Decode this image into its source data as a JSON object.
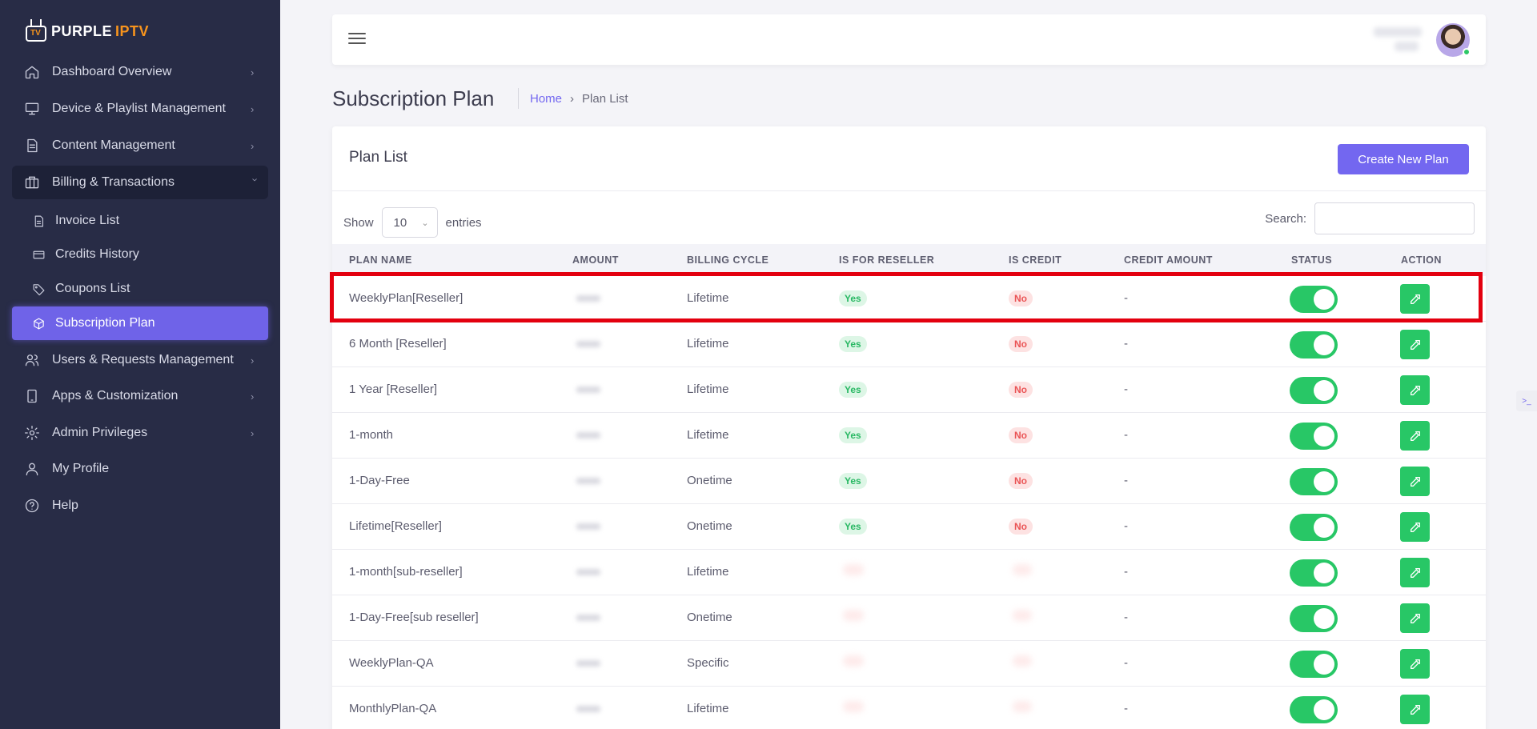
{
  "brand": {
    "name_primary": "PURPLE",
    "name_accent": "IPTV",
    "tv_label": "TV"
  },
  "sidebar": {
    "items": [
      {
        "label": "Dashboard Overview"
      },
      {
        "label": "Device & Playlist Management"
      },
      {
        "label": "Content Management"
      },
      {
        "label": "Billing & Transactions"
      },
      {
        "label": "Users & Requests Management"
      },
      {
        "label": "Apps & Customization"
      },
      {
        "label": "Admin Privileges"
      },
      {
        "label": "My Profile"
      },
      {
        "label": "Help"
      }
    ],
    "billing_sub": [
      {
        "label": "Invoice List"
      },
      {
        "label": "Credits History"
      },
      {
        "label": "Coupons List"
      },
      {
        "label": "Subscription Plan"
      }
    ]
  },
  "page": {
    "title": "Subscription Plan",
    "breadcrumb_home": "Home",
    "breadcrumb_sep": "›",
    "breadcrumb_current": "Plan List"
  },
  "card": {
    "title": "Plan List",
    "create_label": "Create New Plan",
    "show_label": "Show",
    "entries_value": "10",
    "entries_label": "entries",
    "search_label": "Search:"
  },
  "table": {
    "headers": [
      "PLAN NAME",
      "AMOUNT",
      "BILLING CYCLE",
      "IS FOR RESELLER",
      "IS CREDIT",
      "CREDIT AMOUNT",
      "STATUS",
      "ACTION"
    ],
    "rows": [
      {
        "name": "WeeklyPlan[Reseller]",
        "cycle": "Lifetime",
        "reseller": "Yes",
        "credit": "No",
        "credit_amount": "-"
      },
      {
        "name": "6 Month [Reseller]",
        "cycle": "Lifetime",
        "reseller": "Yes",
        "credit": "No",
        "credit_amount": "-"
      },
      {
        "name": "1 Year [Reseller]",
        "cycle": "Lifetime",
        "reseller": "Yes",
        "credit": "No",
        "credit_amount": "-"
      },
      {
        "name": "1-month",
        "cycle": "Lifetime",
        "reseller": "Yes",
        "credit": "No",
        "credit_amount": "-"
      },
      {
        "name": "1-Day-Free",
        "cycle": "Onetime",
        "reseller": "Yes",
        "credit": "No",
        "credit_amount": "-"
      },
      {
        "name": "Lifetime[Reseller]",
        "cycle": "Onetime",
        "reseller": "Yes",
        "credit": "No",
        "credit_amount": "-"
      },
      {
        "name": "1-month[sub-reseller]",
        "cycle": "Lifetime",
        "reseller": "",
        "credit": "",
        "credit_amount": "-"
      },
      {
        "name": "1-Day-Free[sub reseller]",
        "cycle": "Onetime",
        "reseller": "",
        "credit": "",
        "credit_amount": "-"
      },
      {
        "name": "WeeklyPlan-QA",
        "cycle": "Specific",
        "reseller": "",
        "credit": "",
        "credit_amount": "-"
      },
      {
        "name": "MonthlyPlan-QA",
        "cycle": "Lifetime",
        "reseller": "",
        "credit": "",
        "credit_amount": "-"
      }
    ]
  },
  "colors": {
    "accent": "#7367f0",
    "success": "#28c766",
    "danger": "#ea5455",
    "highlight": "#e3000f",
    "sidebar_bg": "#282c46"
  }
}
